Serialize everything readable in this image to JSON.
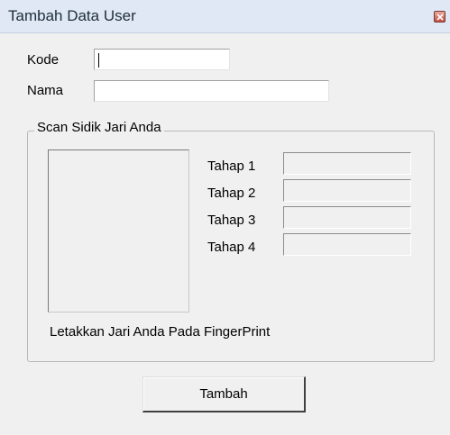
{
  "window": {
    "title": "Tambah Data User",
    "close_icon": "close-icon"
  },
  "form": {
    "kode_label": "Kode",
    "kode_value": "",
    "nama_label": "Nama",
    "nama_value": ""
  },
  "scan_group": {
    "legend": "Scan Sidik Jari Anda",
    "instruction": "Letakkan Jari Anda Pada FingerPrint",
    "stages": [
      {
        "label": "Tahap 1",
        "value": ""
      },
      {
        "label": "Tahap 2",
        "value": ""
      },
      {
        "label": "Tahap 3",
        "value": ""
      },
      {
        "label": "Tahap 4",
        "value": ""
      }
    ]
  },
  "actions": {
    "add_label": "Tambah"
  }
}
